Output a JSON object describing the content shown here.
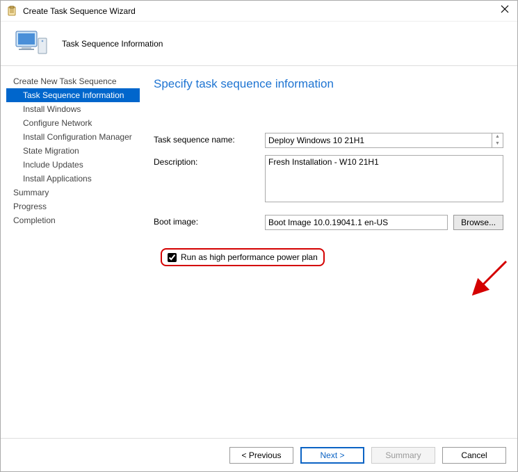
{
  "window": {
    "title": "Create Task Sequence Wizard"
  },
  "header": {
    "title": "Task Sequence Information"
  },
  "sidebar": {
    "items": [
      {
        "label": "Create New Task Sequence",
        "indent": 0,
        "selected": false
      },
      {
        "label": "Task Sequence Information",
        "indent": 1,
        "selected": true
      },
      {
        "label": "Install Windows",
        "indent": 1,
        "selected": false
      },
      {
        "label": "Configure Network",
        "indent": 1,
        "selected": false
      },
      {
        "label": "Install Configuration Manager",
        "indent": 1,
        "selected": false
      },
      {
        "label": "State Migration",
        "indent": 1,
        "selected": false
      },
      {
        "label": "Include Updates",
        "indent": 1,
        "selected": false
      },
      {
        "label": "Install Applications",
        "indent": 1,
        "selected": false
      },
      {
        "label": "Summary",
        "indent": 0,
        "selected": false
      },
      {
        "label": "Progress",
        "indent": 0,
        "selected": false
      },
      {
        "label": "Completion",
        "indent": 0,
        "selected": false
      }
    ]
  },
  "content": {
    "heading": "Specify task sequence information",
    "labels": {
      "name": "Task sequence name:",
      "description": "Description:",
      "boot": "Boot image:"
    },
    "values": {
      "name": "Deploy Windows 10 21H1",
      "description": "Fresh Installation - W10 21H1",
      "boot": "Boot Image 10.0.19041.1 en-US"
    },
    "browse_label": "Browse...",
    "checkbox_label": "Run as high performance power plan",
    "checkbox_checked": true,
    "highlight_checkbox": true,
    "arrow_overlay": true
  },
  "footer": {
    "previous": "< Previous",
    "next": "Next >",
    "summary": "Summary",
    "summary_disabled": true,
    "cancel": "Cancel"
  }
}
